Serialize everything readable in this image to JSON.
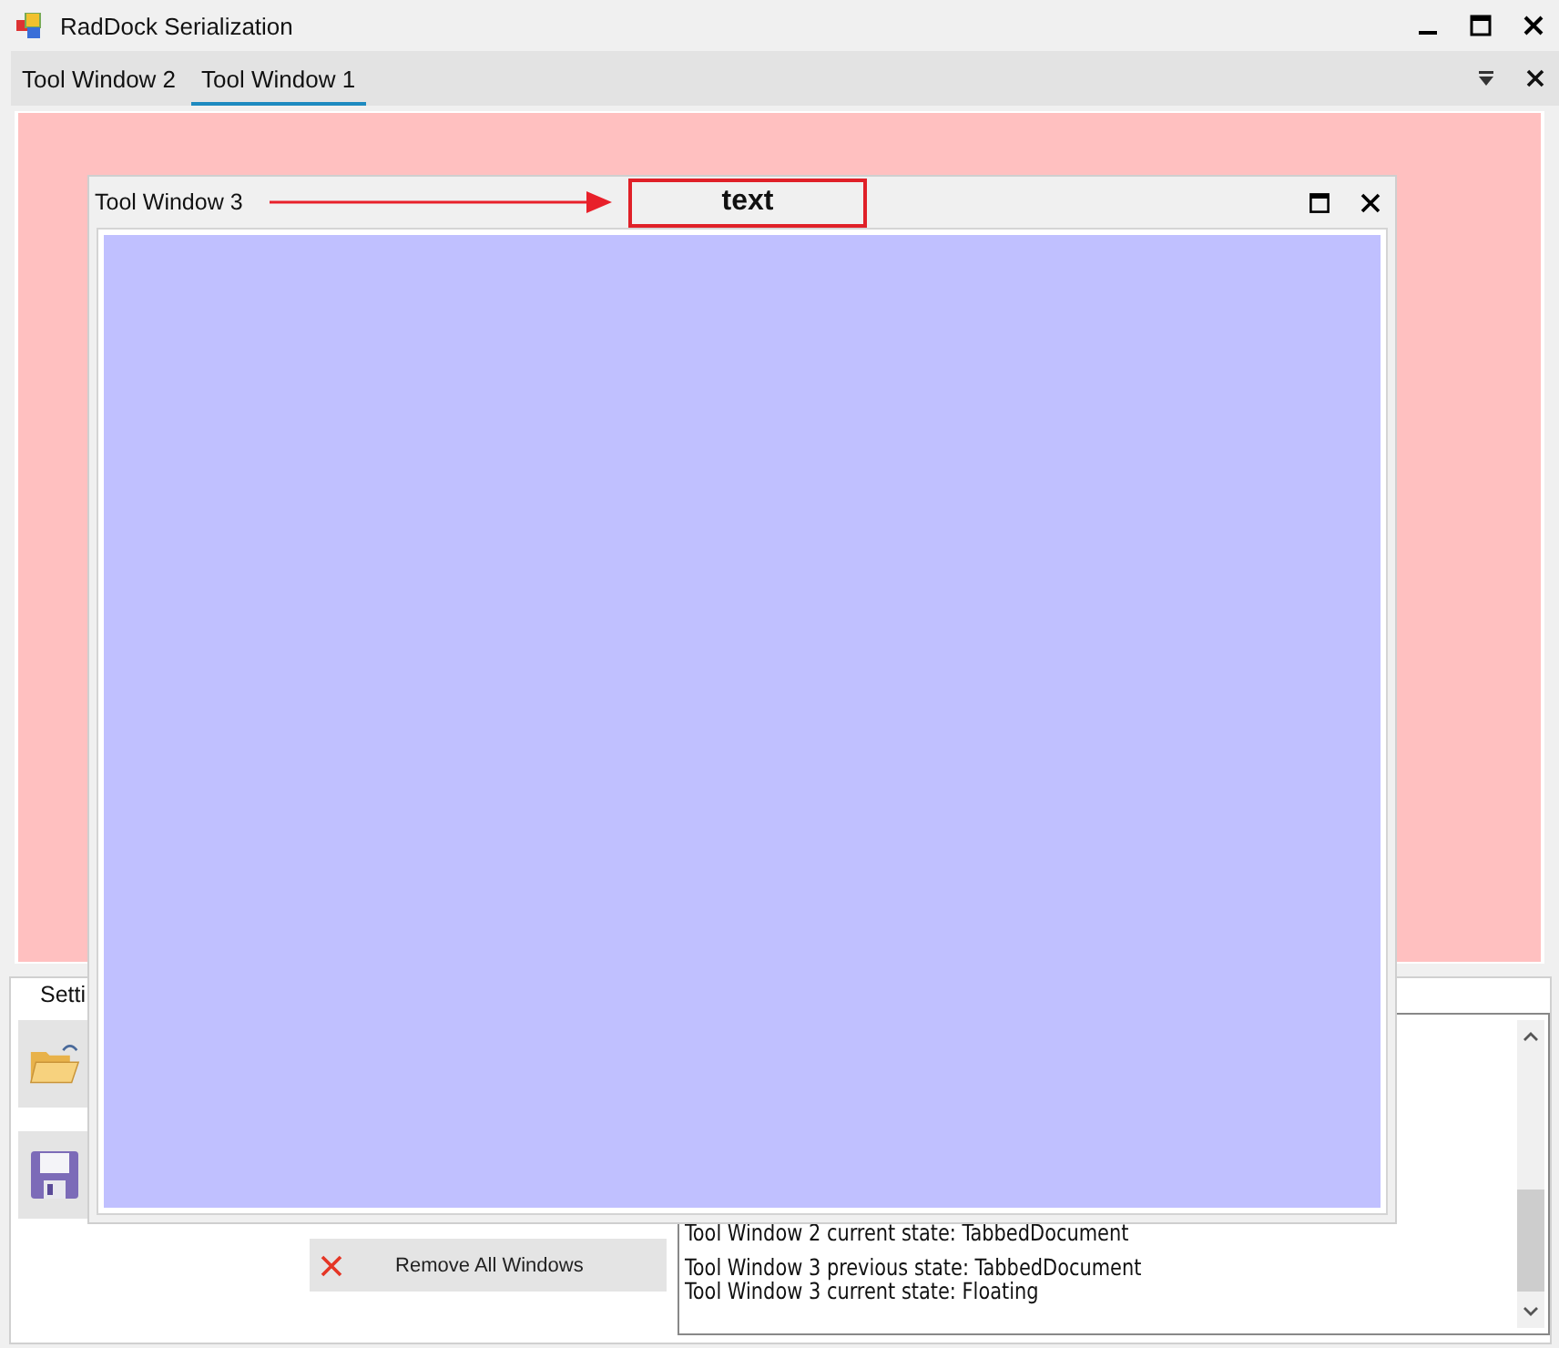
{
  "window": {
    "title": "RadDock Serialization"
  },
  "tabs": [
    {
      "label": "Tool Window 2",
      "selected": false
    },
    {
      "label": "Tool Window 1",
      "selected": true
    }
  ],
  "floating_window": {
    "title": "Tool Window 3",
    "label": "text"
  },
  "bottom_panel": {
    "tab": "Setti",
    "remove_button": "Remove All Windows",
    "log": [
      {
        "lines": [
          "Tool Window 2 current state: TabbedDocument"
        ]
      },
      {
        "lines": [
          "Tool Window 3 previous state: TabbedDocument",
          "Tool Window 3 current state: Floating"
        ]
      }
    ]
  }
}
